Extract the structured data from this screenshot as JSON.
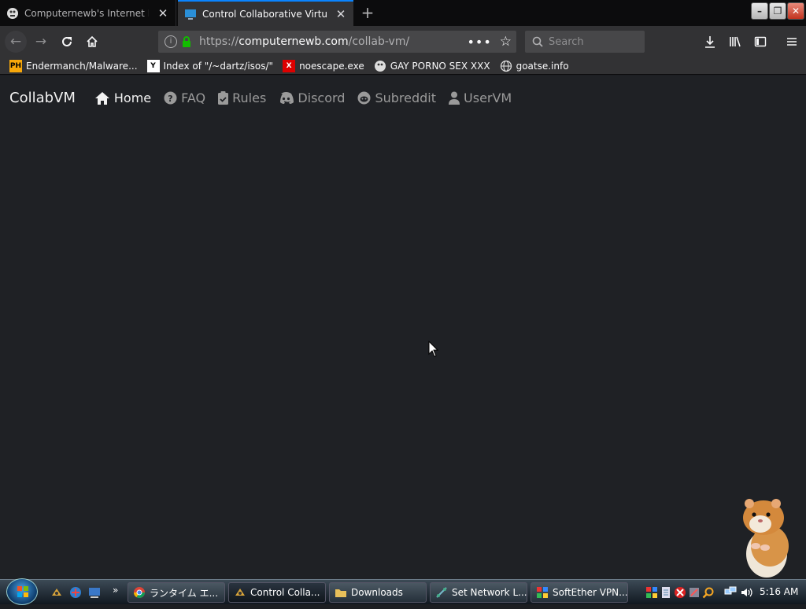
{
  "browser": {
    "tabs": [
      {
        "title": "Computernewb's Internet Pub"
      },
      {
        "title": "Control Collaborative Virtual M"
      }
    ],
    "url": {
      "scheme": "https://",
      "domain": "computernewb.com",
      "path": "/collab-vm/"
    },
    "search_placeholder": "Search",
    "bookmarks": [
      {
        "label": "Endermanch/Malware..."
      },
      {
        "label": "Index of \"/~dartz/isos/\""
      },
      {
        "label": "noescape.exe"
      },
      {
        "label": "GAY PORNO SEX XXX"
      },
      {
        "label": "goatse.info"
      }
    ],
    "bookmark_icon_text": {
      "ph": "PH",
      "yc": "Y",
      "x": "X"
    }
  },
  "site": {
    "brand": "CollabVM",
    "nav": [
      {
        "label": "Home",
        "icon": "home-icon",
        "active": true
      },
      {
        "label": "FAQ",
        "icon": "question-icon"
      },
      {
        "label": "Rules",
        "icon": "clipboard-check-icon"
      },
      {
        "label": "Discord",
        "icon": "discord-icon"
      },
      {
        "label": "Subreddit",
        "icon": "reddit-icon"
      },
      {
        "label": "UserVM",
        "icon": "user-icon"
      }
    ]
  },
  "taskbar": {
    "buttons": [
      {
        "label": "ランタイム エ..."
      },
      {
        "label": "Control Colla...",
        "active": true
      },
      {
        "label": "Downloads"
      },
      {
        "label": "Set Network L..."
      },
      {
        "label": "SoftEther VPN..."
      }
    ],
    "clock": "5:16 AM"
  },
  "colors": {
    "accent": "#0a84ff",
    "page_bg": "#1f2125"
  }
}
